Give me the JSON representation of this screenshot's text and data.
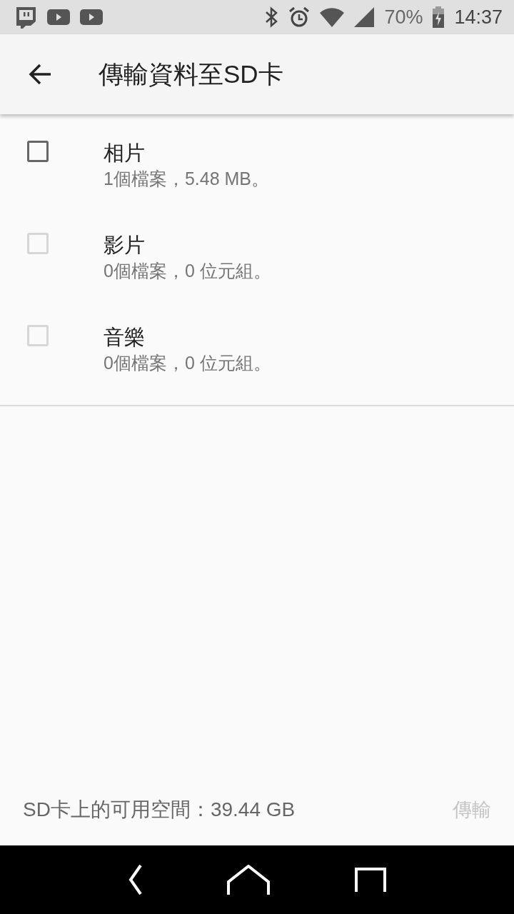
{
  "status_bar": {
    "battery": "70%",
    "time": "14:37"
  },
  "app_bar": {
    "title": "傳輸資料至SD卡"
  },
  "categories": [
    {
      "title": "相片",
      "detail": "1個檔案，5.48 MB。",
      "checked": false,
      "disabled": false
    },
    {
      "title": "影片",
      "detail": "0個檔案，0 位元組。",
      "checked": false,
      "disabled": true
    },
    {
      "title": "音樂",
      "detail": "0個檔案，0 位元組。",
      "checked": false,
      "disabled": true
    }
  ],
  "footer": {
    "free_space": "SD卡上的可用空間：39.44 GB",
    "transfer_button": {
      "label": "傳輸",
      "disabled": true
    }
  }
}
